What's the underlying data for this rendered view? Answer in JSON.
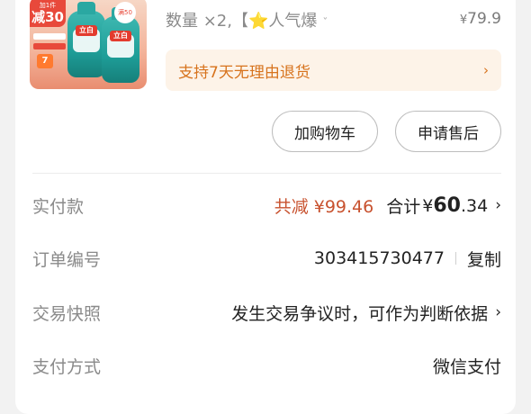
{
  "product": {
    "promo_prefix": "加1件",
    "promo_amount": "减30",
    "badge": "满50",
    "brand_logo": "立白",
    "thumb_number": "7",
    "quantity_text": "数量 ×2,【",
    "star": "⭐",
    "variant_text": "人气爆",
    "variant_chevron": "ˇ",
    "price_currency": "¥",
    "price_value": "79.9"
  },
  "return_policy": {
    "text": "支持7天无理由退货",
    "chevron": "›"
  },
  "actions": {
    "add_cart": "加购物车",
    "after_sale": "申请售后"
  },
  "payment": {
    "label": "实付款",
    "discount": "共减 ¥99.46",
    "total_label": "合计",
    "total_currency": "¥",
    "total_int": "60",
    "total_dec": ".34",
    "chevron": "›"
  },
  "order": {
    "label": "订单编号",
    "number": "303415730477",
    "copy": "复制"
  },
  "snapshot": {
    "label": "交易快照",
    "text": "发生交易争议时，可作为判断依据",
    "chevron": "›"
  },
  "pay_method": {
    "label": "支付方式",
    "value": "微信支付"
  },
  "colors": {
    "accent_orange": "#d7731d",
    "discount_red": "#c8522f",
    "return_bg": "#fdf3e8"
  }
}
